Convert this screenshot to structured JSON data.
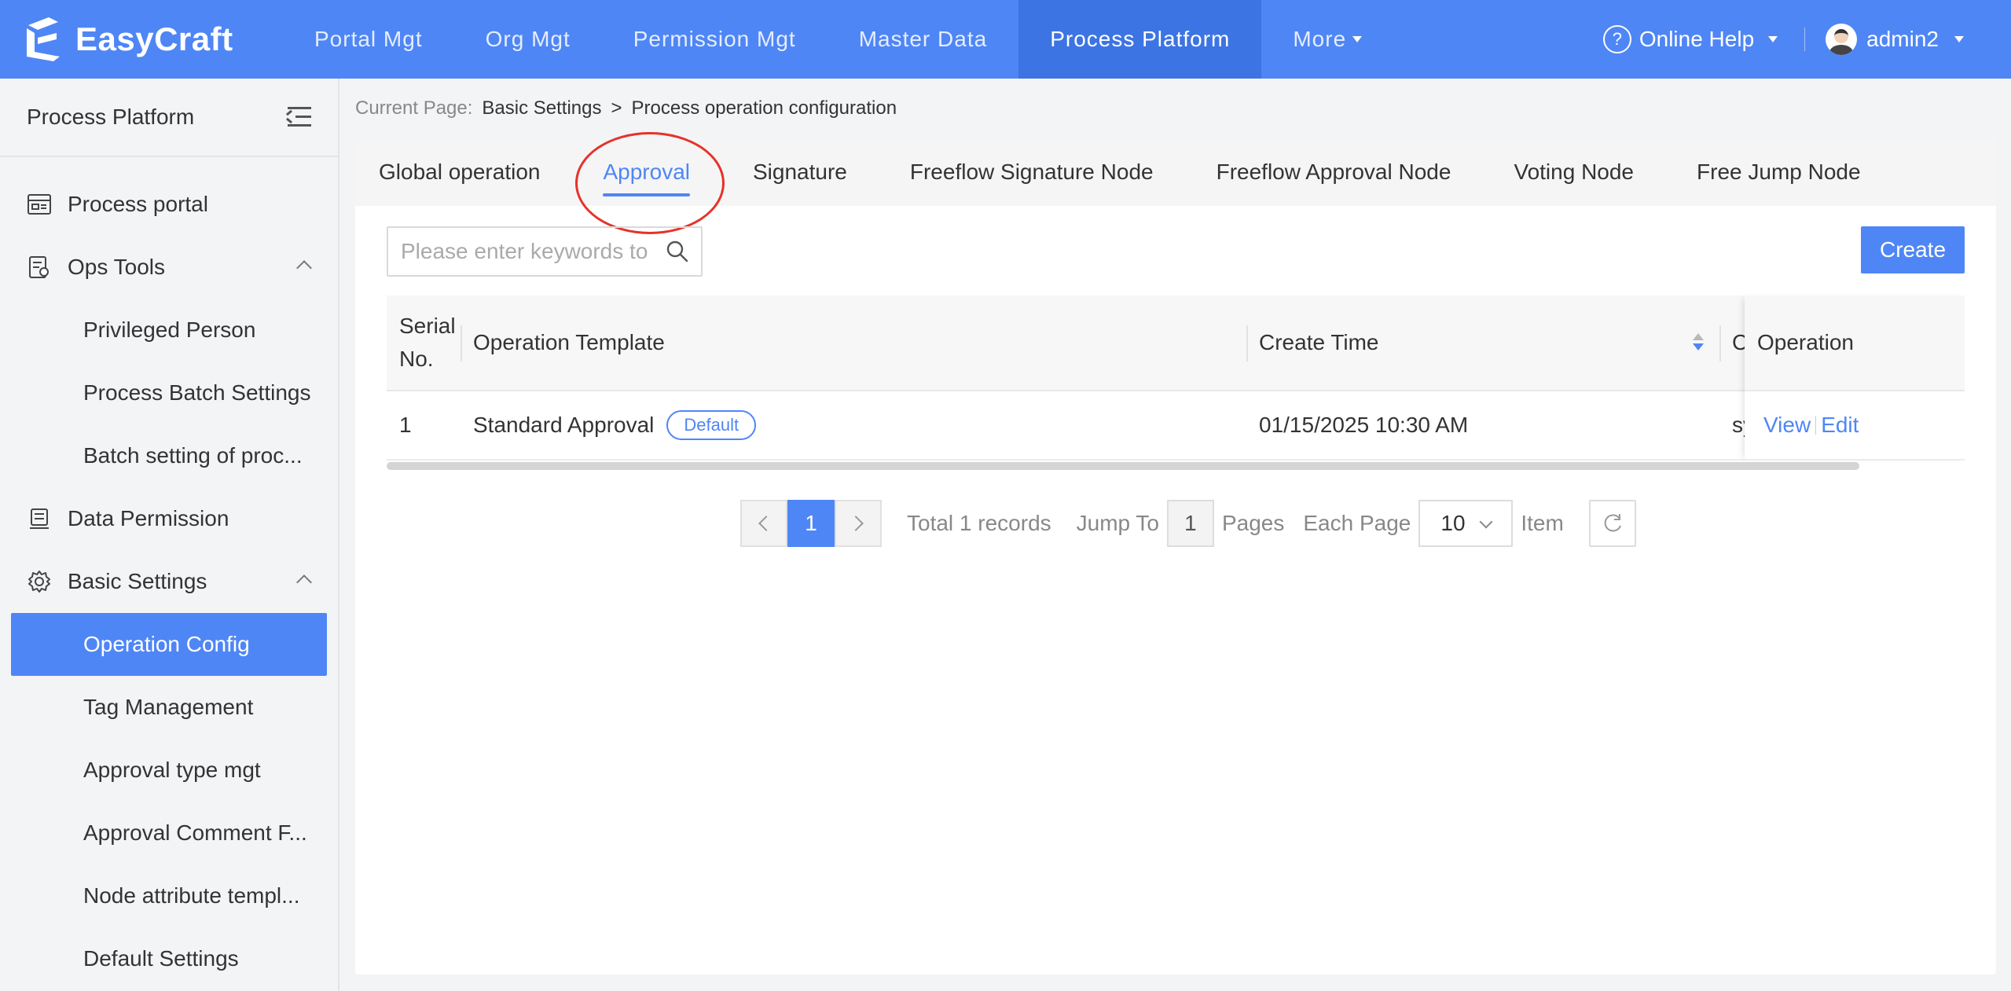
{
  "app": {
    "logo_text": "EasyCraft",
    "nav": [
      "Portal Mgt",
      "Org Mgt",
      "Permission Mgt",
      "Master Data",
      "Process Platform",
      "More"
    ],
    "active_nav": "Process Platform",
    "online_help": "Online Help",
    "username": "admin2"
  },
  "sidebar": {
    "title": "Process Platform",
    "items": [
      {
        "label": "Process portal"
      },
      {
        "label": "Ops Tools"
      },
      {
        "label": "Privileged Person"
      },
      {
        "label": "Process Batch Settings"
      },
      {
        "label": "Batch setting of proc..."
      },
      {
        "label": "Data Permission"
      },
      {
        "label": "Basic Settings"
      },
      {
        "label": "Operation Config"
      },
      {
        "label": "Tag Management"
      },
      {
        "label": "Approval type mgt"
      },
      {
        "label": "Approval Comment F..."
      },
      {
        "label": "Node attribute templ..."
      },
      {
        "label": "Default Settings"
      }
    ]
  },
  "breadcrumb": {
    "prefix": "Current Page:",
    "parent": "Basic Settings",
    "separator": ">",
    "current": "Process operation configuration"
  },
  "tabs": [
    "Global operation",
    "Approval",
    "Signature",
    "Freeflow Signature Node",
    "Freeflow Approval Node",
    "Voting Node",
    "Free Jump Node"
  ],
  "active_tab": "Approval",
  "search": {
    "placeholder": "Please enter keywords to search"
  },
  "create_label": "Create",
  "table": {
    "headers": {
      "serial_line1": "Serial",
      "serial_line2": "No.",
      "template": "Operation Template",
      "create_time": "Create Time",
      "creator_cut": "C",
      "operation": "Operation"
    },
    "rows": [
      {
        "serial": "1",
        "template": "Standard Approval",
        "badge": "Default",
        "create_time": "01/15/2025 10:30 AM",
        "creator_cut": "sy",
        "view": "View",
        "edit": "Edit"
      }
    ]
  },
  "pagination": {
    "current_page": "1",
    "total_text": "Total 1 records",
    "jump_to": "Jump To",
    "jump_value": "1",
    "pages": "Pages",
    "each_page": "Each Page",
    "page_size": "10",
    "item": "Item"
  },
  "colors": {
    "primary": "#4f86f5",
    "highlight_circle": "#e5332a"
  }
}
